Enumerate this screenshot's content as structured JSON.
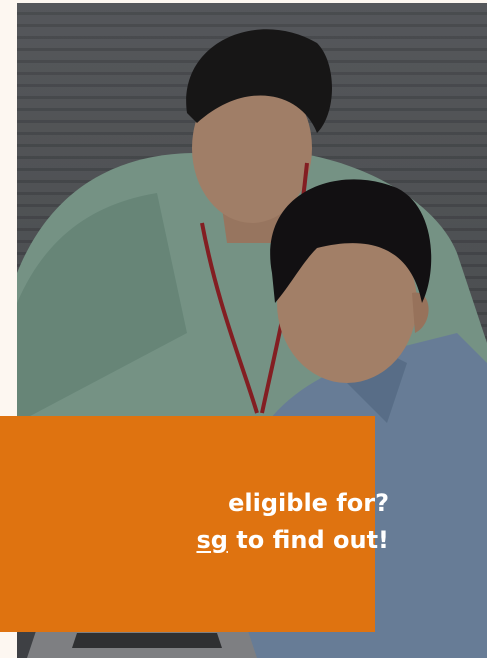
{
  "banner": {
    "line1": "eligible for?",
    "line2_link": "sg",
    "line2_rest": " to find out!"
  },
  "colors": {
    "banner_bg": "#df7310",
    "page_bg": "#fdf7f1"
  },
  "photo": {
    "icon": "photo-two-students-at-laptop"
  }
}
